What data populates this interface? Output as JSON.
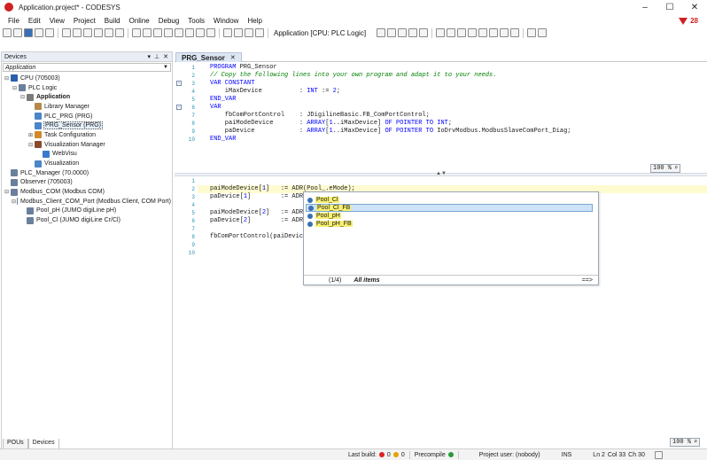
{
  "window": {
    "title": "Application.project* - CODESYS",
    "controls": {
      "minimize": "–",
      "maximize": "☐",
      "close": "✕"
    }
  },
  "menu": {
    "items": [
      "File",
      "Edit",
      "View",
      "Project",
      "Build",
      "Online",
      "Debug",
      "Tools",
      "Window",
      "Help"
    ],
    "message_count": "28",
    "accent_color": "#d02020"
  },
  "toolbar": {
    "active_app_label": "Application [CPU: PLC Logic]"
  },
  "devices": {
    "title": "Devices",
    "header_icons": [
      "▾",
      "📌",
      "✕"
    ],
    "combo_value": "Application",
    "tree": [
      {
        "level": 0,
        "toggle": "⊟",
        "label": "CPU (705003)",
        "icon": "cpu-icon",
        "color": "#2a5faa"
      },
      {
        "level": 1,
        "toggle": "⊟",
        "label": "PLC Logic",
        "icon": "plc-logic-icon",
        "color": "#6a7f9c"
      },
      {
        "level": 2,
        "toggle": "⊟",
        "label": "Application",
        "icon": "application-icon",
        "color": "#7a7a7a",
        "bold": true
      },
      {
        "level": 3,
        "toggle": "",
        "label": "Library Manager",
        "icon": "library-icon",
        "color": "#b5894a"
      },
      {
        "level": 3,
        "toggle": "",
        "label": "PLC_PRG (PRG)",
        "icon": "pou-icon",
        "color": "#4a86c8"
      },
      {
        "level": 3,
        "toggle": "",
        "label": "PRG_Sensor (PRG)",
        "icon": "pou-icon",
        "color": "#4a86c8",
        "selected": true
      },
      {
        "level": 3,
        "toggle": "⊞",
        "label": "Task Configuration",
        "icon": "task-icon",
        "color": "#d08a2a"
      },
      {
        "level": 3,
        "toggle": "⊟",
        "label": "Visualization Manager",
        "icon": "visu-manager-icon",
        "color": "#8a4a2a"
      },
      {
        "level": 4,
        "toggle": "",
        "label": "WebVisu",
        "icon": "webvisu-icon",
        "color": "#3a7acc"
      },
      {
        "level": 3,
        "toggle": "",
        "label": "Visualization",
        "icon": "visualization-icon",
        "color": "#4a86c8"
      },
      {
        "level": 0,
        "toggle": "",
        "label": "PLC_Manager (70.0000)",
        "icon": "device-icon",
        "color": "#6a7f9c"
      },
      {
        "level": 0,
        "toggle": "",
        "label": "Observer (705003)",
        "icon": "device-icon",
        "color": "#6a7f9c"
      },
      {
        "level": 0,
        "toggle": "⊟",
        "label": "Modbus_COM (Modbus COM)",
        "icon": "modbus-icon",
        "color": "#6a7f9c"
      },
      {
        "level": 1,
        "toggle": "⊟",
        "label": "Modbus_Client_COM_Port (Modbus Client, COM Port)",
        "icon": "modbus-client-icon",
        "color": "#6a7f9c"
      },
      {
        "level": 2,
        "toggle": "",
        "label": "Pool_pH (JUMO digiLine pH)",
        "icon": "sensor-icon",
        "color": "#6a7f9c"
      },
      {
        "level": 2,
        "toggle": "",
        "label": "Pool_Cl (JUMO digiLine Cr/Cl)",
        "icon": "sensor-icon",
        "color": "#6a7f9c"
      }
    ],
    "tabs": [
      "POUs",
      "Devices"
    ]
  },
  "editor": {
    "tab_label": "PRG_Sensor",
    "tab_close": "✕",
    "decl_zoom": "100 %",
    "impl_zoom": "100 %",
    "divider_grip": "▲▼",
    "declaration": [
      {
        "n": "1",
        "parts": [
          [
            "kw",
            "PROGRAM "
          ],
          [
            "",
            "PRG_Sensor"
          ]
        ]
      },
      {
        "n": "2",
        "parts": [
          [
            "cm",
            "// Copy the following lines into your own program and adapt it to your needs."
          ]
        ]
      },
      {
        "n": "3",
        "parts": [
          [
            "kw",
            "VAR CONSTANT"
          ]
        ],
        "fold": "⊟"
      },
      {
        "n": "4",
        "parts": [
          [
            "",
            "    iMaxDevice          : "
          ],
          [
            "kw",
            "INT"
          ],
          [
            "",
            " := "
          ],
          [
            "num",
            "2"
          ],
          [
            "",
            ";"
          ]
        ]
      },
      {
        "n": "5",
        "parts": [
          [
            "kw",
            "END_VAR"
          ]
        ]
      },
      {
        "n": "6",
        "parts": [
          [
            "kw",
            "VAR"
          ]
        ],
        "fold": "⊟"
      },
      {
        "n": "7",
        "parts": [
          [
            "",
            "    fbComPortControl    : JDigilineBasic.FB_ComPortControl;"
          ]
        ]
      },
      {
        "n": "8",
        "parts": [
          [
            "",
            "    paiModeDevice       : "
          ],
          [
            "kw",
            "ARRAY"
          ],
          [
            "",
            "["
          ],
          [
            "num",
            "1"
          ],
          [
            "",
            "..iMaxDevice] "
          ],
          [
            "kw",
            "OF POINTER TO INT"
          ],
          [
            "",
            ";"
          ]
        ]
      },
      {
        "n": "9",
        "parts": [
          [
            "",
            "    paDevice            : "
          ],
          [
            "kw",
            "ARRAY"
          ],
          [
            "",
            "["
          ],
          [
            "num",
            "1"
          ],
          [
            "",
            "..iMaxDevice] "
          ],
          [
            "kw",
            "OF POINTER TO"
          ],
          [
            "",
            " IoDrvModbus.ModbusSlaveComPort_Diag;"
          ]
        ]
      },
      {
        "n": "10",
        "parts": [
          [
            "kw",
            "END_VAR"
          ]
        ]
      }
    ],
    "implementation": [
      {
        "n": "1",
        "parts": [
          [
            "",
            ""
          ]
        ]
      },
      {
        "n": "2",
        "parts": [
          [
            "",
            "paiModeDevice["
          ],
          [
            "num",
            "1"
          ],
          [
            "",
            "]   := ADR(Pool_.eMode);"
          ]
        ],
        "highlight": true
      },
      {
        "n": "3",
        "parts": [
          [
            "",
            "paDevice["
          ],
          [
            "num",
            "1"
          ],
          [
            "",
            "]        := ADR("
          ]
        ]
      },
      {
        "n": "4",
        "parts": [
          [
            "",
            ""
          ]
        ]
      },
      {
        "n": "5",
        "parts": [
          [
            "",
            "paiModeDevice["
          ],
          [
            "num",
            "2"
          ],
          [
            "",
            "]   := ADR("
          ]
        ]
      },
      {
        "n": "6",
        "parts": [
          [
            "",
            "paDevice["
          ],
          [
            "num",
            "2"
          ],
          [
            "",
            "]        := ADR("
          ]
        ]
      },
      {
        "n": "7",
        "parts": [
          [
            "",
            ""
          ]
        ]
      },
      {
        "n": "8",
        "parts": [
          [
            "",
            "fbComPortControl(paiDeviceM"
          ]
        ]
      },
      {
        "n": "9",
        "parts": [
          [
            "",
            ""
          ]
        ]
      },
      {
        "n": "10",
        "parts": [
          [
            "",
            ""
          ]
        ]
      }
    ]
  },
  "autocomplete": {
    "items": [
      {
        "label": "Pool_Cl",
        "selected": false
      },
      {
        "label": "Pool_Cl_FB",
        "selected": true
      },
      {
        "label": "Pool_pH",
        "selected": false
      },
      {
        "label": "Pool_pH_FB",
        "selected": false
      }
    ],
    "count": "(1/4)",
    "filter": "All items",
    "more": "==>"
  },
  "statusbar": {
    "last_build_label": "Last build:",
    "errors": "0",
    "warnings": "0",
    "precompile": "Precompile",
    "project_user": "Project user: (nobody)",
    "mode": "INS",
    "ln": "Ln 2",
    "col": "Col 33",
    "ch": "Ch 30"
  }
}
